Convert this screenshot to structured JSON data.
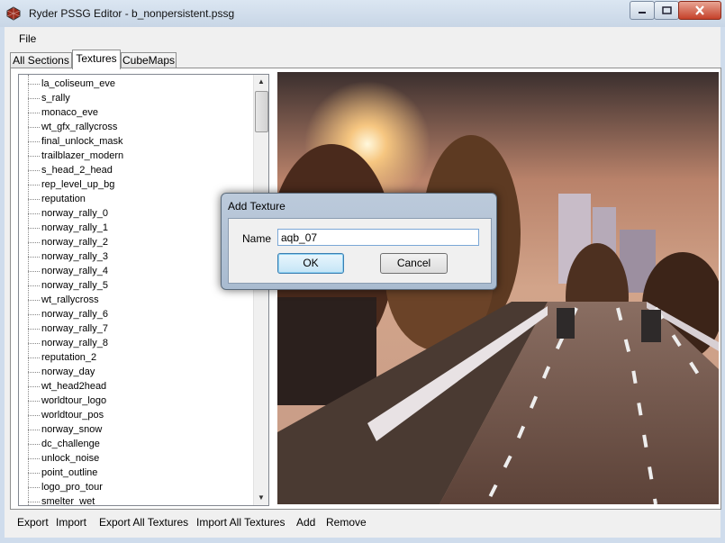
{
  "window": {
    "title": "Ryder PSSG Editor - b_nonpersistent.pssg"
  },
  "menu": {
    "file": "File"
  },
  "tabs": [
    "All Sections",
    "Textures",
    "CubeMaps"
  ],
  "textures": [
    "la_coliseum_eve",
    "s_rally",
    "monaco_eve",
    "wt_gfx_rallycross",
    "final_unlock_mask",
    "trailblazer_modern",
    "s_head_2_head",
    "rep_level_up_bg",
    "reputation",
    "norway_rally_0",
    "norway_rally_1",
    "norway_rally_2",
    "norway_rally_3",
    "norway_rally_4",
    "norway_rally_5",
    "wt_rallycross",
    "norway_rally_6",
    "norway_rally_7",
    "norway_rally_8",
    "reputation_2",
    "norway_day",
    "wt_head2head",
    "worldtour_logo",
    "worldtour_pos",
    "norway_snow",
    "dc_challenge",
    "unlock_noise",
    "point_outline",
    "logo_pro_tour",
    "smelter_wet"
  ],
  "toolbar": {
    "export": "Export",
    "import": "Import",
    "export_all": "Export All Textures",
    "import_all": "Import All Textures",
    "add": "Add",
    "remove": "Remove"
  },
  "dialog": {
    "title": "Add Texture",
    "name_label": "Name",
    "name_value": "aqb_07",
    "ok": "OK",
    "cancel": "Cancel"
  },
  "colors": {
    "accent": "#3c7fb1",
    "titlebar": "#c8d6e6",
    "close": "#c5412a"
  }
}
